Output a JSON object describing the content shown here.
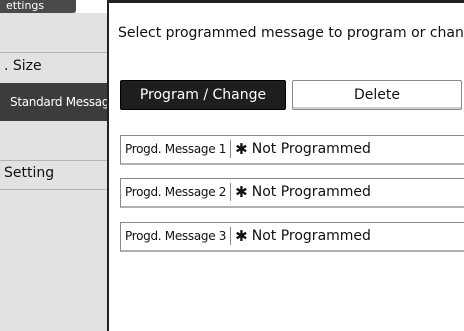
{
  "sidebar": {
    "top_tab": "ettings",
    "items": [
      {
        "label": ". Size"
      },
      {
        "label": "Standard Message"
      },
      {
        "label": "Setting"
      }
    ]
  },
  "main": {
    "instruction": "Select programmed message to program or change.",
    "buttons": {
      "program_change": "Program / Change",
      "delete": "Delete"
    },
    "messages": [
      {
        "label": "Progd. Message 1",
        "marker": "✱",
        "status": "Not Programmed"
      },
      {
        "label": "Progd. Message 2",
        "marker": "✱",
        "status": "Not Programmed"
      },
      {
        "label": "Progd. Message 3",
        "marker": "✱",
        "status": "Not Programmed"
      }
    ]
  }
}
